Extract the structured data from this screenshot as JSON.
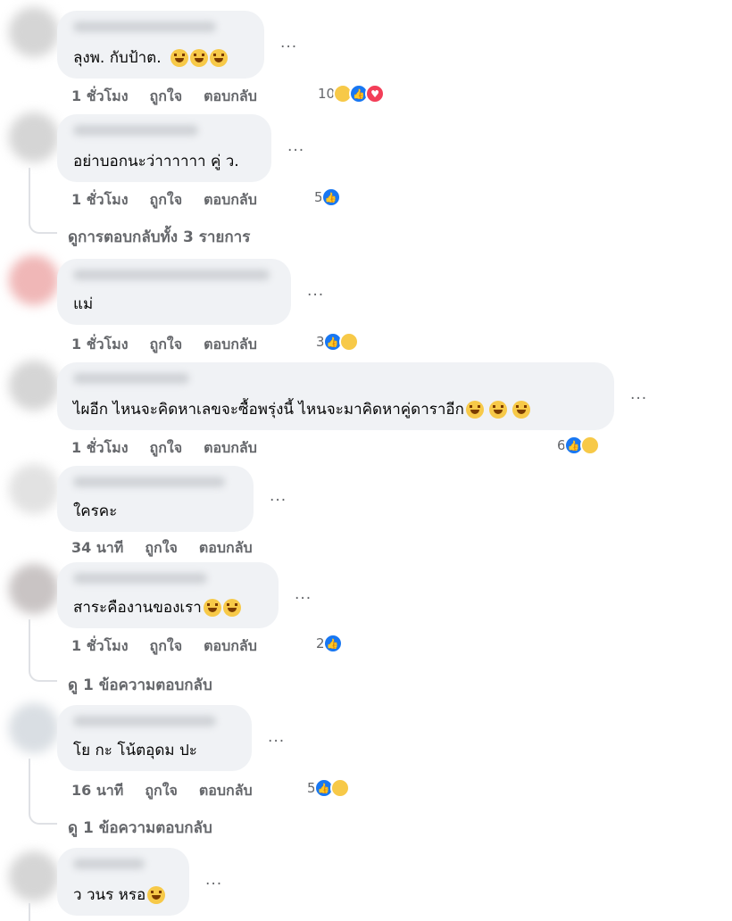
{
  "actions": {
    "like": "ถูกใจ",
    "reply": "ตอบกลับ"
  },
  "more_label": "...",
  "comments": [
    {
      "text": "ลุงพ. กับป้าต.",
      "time": "1 ชั่วโมง",
      "reaction_count": "10",
      "reactions": [
        "haha",
        "like",
        "love"
      ],
      "text_emoji": [
        "sad-face",
        "sad-face",
        "sad-face"
      ]
    },
    {
      "text": "อย่าบอกนะว่าาาาาา คู่ ว.",
      "time": "1 ชั่วโมง",
      "reaction_count": "5",
      "reactions": [
        "like"
      ],
      "view_replies": "ดูการตอบกลับทั้ง 3 รายการ"
    },
    {
      "text": "แม่",
      "time": "1 ชั่วโมง",
      "reaction_count": "3",
      "reactions": [
        "like",
        "care"
      ]
    },
    {
      "text": "ไผอีก ไหนจะคิดหาเลขจะซื้อพรุ่งนี้ ไหนจะมาคิดหาคู่ดาราอีก",
      "time": "1 ชั่วโมง",
      "reaction_count": "6",
      "reactions": [
        "like",
        "haha"
      ],
      "text_emoji": [
        "rofl",
        "rofl",
        "rofl"
      ]
    },
    {
      "text": "ใครคะ",
      "time": "34 นาที"
    },
    {
      "text": "สาระคืองานของเรา",
      "time": "1 ชั่วโมง",
      "reaction_count": "2",
      "reactions": [
        "like"
      ],
      "text_emoji": [
        "joy",
        "joy"
      ],
      "view_replies": "ดู 1 ข้อความตอบกลับ"
    },
    {
      "text": "โย กะ โน้ตอุดม ปะ",
      "time": "16 นาที",
      "reaction_count": "5",
      "reactions": [
        "like",
        "haha"
      ],
      "view_replies": "ดู 1 ข้อความตอบกลับ"
    },
    {
      "text": "ว วนร หรอ",
      "text_emoji": [
        "smile"
      ]
    }
  ],
  "colors": {
    "bubble": "#f0f2f5",
    "meta": "#65676b",
    "text": "#050505",
    "like": "#1877f2",
    "love": "#f33e58",
    "haha": "#f7c948"
  }
}
